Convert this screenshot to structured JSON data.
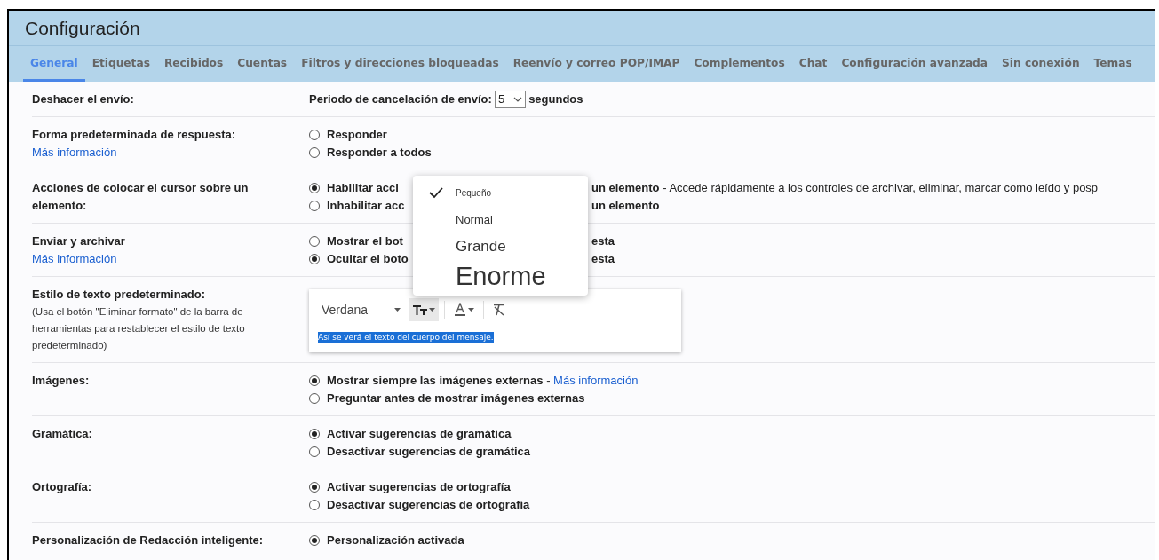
{
  "window": {
    "title": "Configuración"
  },
  "tabs": [
    {
      "label": "General",
      "selected": true
    },
    {
      "label": "Etiquetas",
      "selected": false
    },
    {
      "label": "Recibidos",
      "selected": false
    },
    {
      "label": "Cuentas",
      "selected": false
    },
    {
      "label": "Filtros y direcciones bloqueadas",
      "selected": false
    },
    {
      "label": "Reenvío y correo POP/IMAP",
      "selected": false
    },
    {
      "label": "Complementos",
      "selected": false
    },
    {
      "label": "Chat",
      "selected": false
    },
    {
      "label": "Configuración avanzada",
      "selected": false
    },
    {
      "label": "Sin conexión",
      "selected": false
    },
    {
      "label": "Temas",
      "selected": false
    }
  ],
  "settings": [
    {
      "kind": "select",
      "label": "Deshacer el envío:",
      "prefix": "Periodo de cancelación de envío:",
      "value": "5",
      "suffix": "segundos"
    },
    {
      "kind": "radio",
      "label": "Forma predeterminada de respuesta:",
      "link": "Más información",
      "options": [
        {
          "selected": false,
          "parts": [
            {
              "kind": "strong",
              "text": "Responder"
            }
          ]
        },
        {
          "selected": false,
          "parts": [
            {
              "kind": "strong",
              "text": "Responder a todos"
            }
          ]
        }
      ]
    },
    {
      "kind": "radio",
      "label": "Acciones de colocar el cursor sobre un elemento:",
      "options": [
        {
          "selected": true,
          "parts": [
            {
              "kind": "strong",
              "text": "Habilitar acci"
            },
            {
              "kind": "gap"
            },
            {
              "kind": "strong",
              "text": "un elemento"
            },
            {
              "kind": "plain",
              "text": " - Accede rápidamente a los controles de archivar, eliminar, marcar como leído y posp"
            }
          ]
        },
        {
          "selected": false,
          "parts": [
            {
              "kind": "strong",
              "text": "Inhabilitar acc"
            },
            {
              "kind": "gap"
            },
            {
              "kind": "strong",
              "text": "un elemento"
            }
          ]
        }
      ]
    },
    {
      "kind": "radio",
      "label": "Enviar y archivar",
      "link": "Más información",
      "options": [
        {
          "selected": false,
          "parts": [
            {
              "kind": "strong",
              "text": "Mostrar el bot"
            },
            {
              "kind": "gap"
            },
            {
              "kind": "strong",
              "text": "esta"
            }
          ]
        },
        {
          "selected": true,
          "parts": [
            {
              "kind": "strong",
              "text": "Ocultar el boto"
            },
            {
              "kind": "gap"
            },
            {
              "kind": "strong",
              "text": "esta"
            }
          ]
        }
      ]
    },
    {
      "kind": "editor",
      "label": "Estilo de texto predeterminado:",
      "note": "(Usa el botón \"Eliminar formato\" de la barra de herramientas para restablecer el estilo de texto predeterminado)",
      "font": "Verdana",
      "sample": "Así se verá el texto del cuerpo del mensaje."
    },
    {
      "kind": "radio",
      "label": "Imágenes:",
      "options": [
        {
          "selected": true,
          "parts": [
            {
              "kind": "strong",
              "text": "Mostrar siempre las imágenes externas"
            },
            {
              "kind": "plain",
              "text": " - "
            },
            {
              "kind": "link",
              "text": "Más información"
            }
          ]
        },
        {
          "selected": false,
          "parts": [
            {
              "kind": "strong",
              "text": "Preguntar antes de mostrar imágenes externas"
            }
          ]
        }
      ]
    },
    {
      "kind": "radio",
      "label": "Gramática:",
      "options": [
        {
          "selected": true,
          "parts": [
            {
              "kind": "strong",
              "text": "Activar sugerencias de gramática"
            }
          ]
        },
        {
          "selected": false,
          "parts": [
            {
              "kind": "strong",
              "text": "Desactivar sugerencias de gramática"
            }
          ]
        }
      ]
    },
    {
      "kind": "radio",
      "label": "Ortografía:",
      "options": [
        {
          "selected": true,
          "parts": [
            {
              "kind": "strong",
              "text": "Activar sugerencias de ortografía"
            }
          ]
        },
        {
          "selected": false,
          "parts": [
            {
              "kind": "strong",
              "text": "Desactivar sugerencias de ortografía"
            }
          ]
        }
      ]
    },
    {
      "kind": "radio",
      "label": "Personalización de Redacción inteligente:",
      "options": [
        {
          "selected": true,
          "parts": [
            {
              "kind": "strong",
              "text": "Personalización activada"
            }
          ]
        }
      ]
    }
  ],
  "size_menu": {
    "items": [
      {
        "label": "Pequeño",
        "kind": "small",
        "selected": true
      },
      {
        "label": "Normal",
        "kind": "normal",
        "selected": false
      },
      {
        "label": "Grande",
        "kind": "large",
        "selected": false
      },
      {
        "label": "Enorme",
        "kind": "huge",
        "selected": false
      }
    ]
  }
}
